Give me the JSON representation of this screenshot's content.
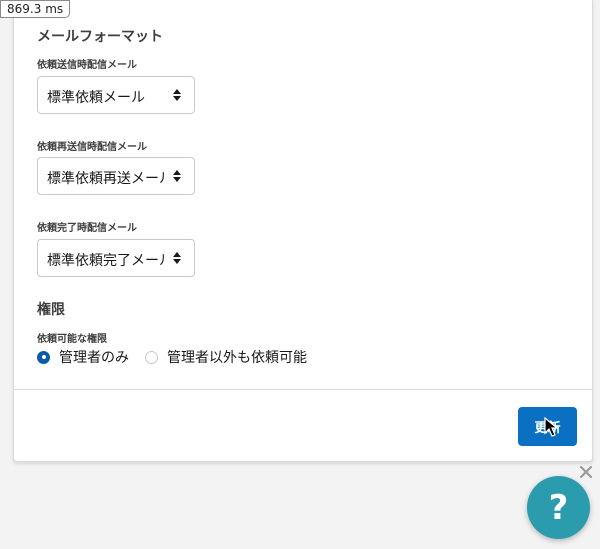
{
  "timer": {
    "value": "869.3",
    "unit": "ms"
  },
  "mail_format": {
    "title": "メールフォーマット",
    "fields": [
      {
        "label": "依頼送信時配信メール",
        "selected": "標準依頼メール"
      },
      {
        "label": "依頼再送信時配信メール",
        "selected": "標準依頼再送メール"
      },
      {
        "label": "依頼完了時配信メール",
        "selected": "標準依頼完了メール"
      }
    ]
  },
  "permission": {
    "title": "権限",
    "label": "依頼可能な権限",
    "options": [
      {
        "label": "管理者のみ",
        "checked": true
      },
      {
        "label": "管理者以外も依頼可能",
        "checked": false
      }
    ]
  },
  "footer": {
    "update_label": "更新"
  },
  "help": {
    "icon": "question-mark-icon",
    "close_icon": "close-icon",
    "color": "#2b9bae"
  },
  "colors": {
    "primary": "#0b70c2",
    "radio": "#0b5cab"
  },
  "loading": {
    "icon": "loading-spinner-icon"
  }
}
